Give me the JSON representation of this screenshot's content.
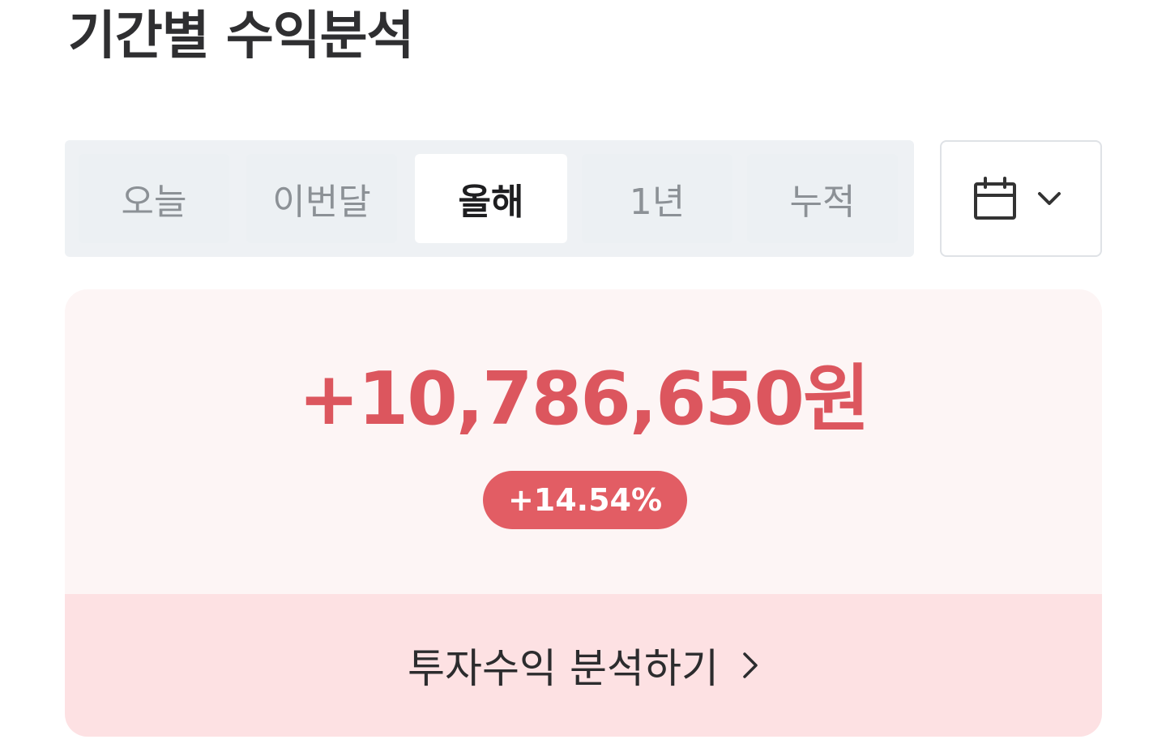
{
  "header": {
    "title": "기간별 수익분석"
  },
  "period_tabs": {
    "items": [
      "오늘",
      "이번달",
      "올해",
      "1년",
      "누적"
    ],
    "selected": "올해"
  },
  "date_picker": {
    "icon": "calendar-icon",
    "dropdown_icon": "chevron-down-icon"
  },
  "summary": {
    "profit_amount": "+10,786,650원",
    "return_rate": "+14.54%",
    "analysis_link_label": "투자수익 분석하기",
    "analysis_link_icon": "chevron-right-icon"
  },
  "colors": {
    "profit_red": "#dc565e",
    "badge_red": "#e25d64",
    "card_background": "#fdf5f5",
    "link_background": "#fde1e3",
    "tab_track": "#eef1f4"
  }
}
